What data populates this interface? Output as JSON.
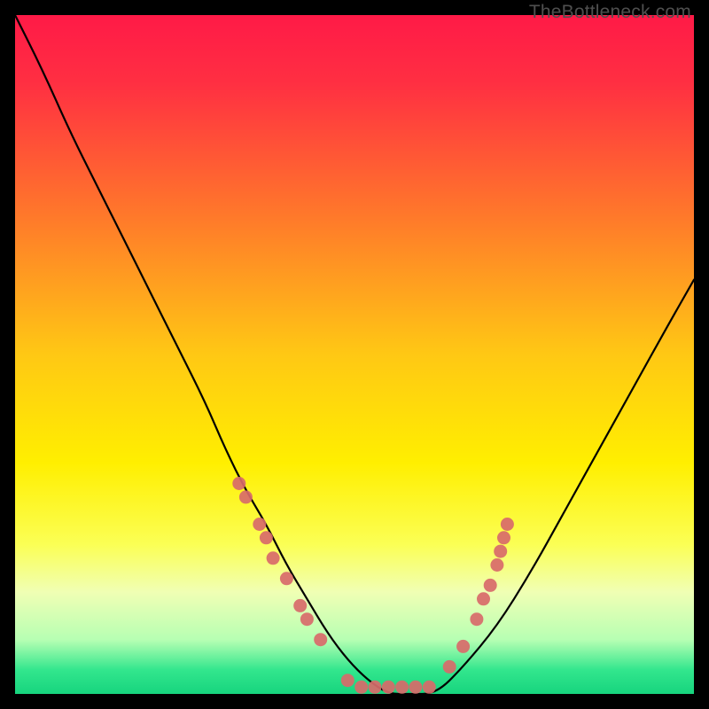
{
  "watermark": "TheBottleneck.com",
  "chart_data": {
    "type": "line",
    "title": "",
    "xlabel": "",
    "ylabel": "",
    "xlim": [
      0,
      100
    ],
    "ylim": [
      0,
      100
    ],
    "background_gradient_stops": [
      {
        "offset": 0.0,
        "color": "#ff1a47"
      },
      {
        "offset": 0.1,
        "color": "#ff2f42"
      },
      {
        "offset": 0.3,
        "color": "#ff7a2a"
      },
      {
        "offset": 0.5,
        "color": "#ffc814"
      },
      {
        "offset": 0.66,
        "color": "#ffef00"
      },
      {
        "offset": 0.78,
        "color": "#fbff55"
      },
      {
        "offset": 0.85,
        "color": "#f0ffb4"
      },
      {
        "offset": 0.92,
        "color": "#b7ffb3"
      },
      {
        "offset": 0.965,
        "color": "#32e68d"
      },
      {
        "offset": 1.0,
        "color": "#17d47e"
      }
    ],
    "series": [
      {
        "name": "bottleneck-curve",
        "color": "#000000",
        "x": [
          0,
          4,
          8,
          12,
          16,
          20,
          24,
          28,
          31,
          34,
          37,
          40,
          43,
          46,
          49,
          52,
          55,
          58,
          62,
          66,
          71,
          76,
          81,
          86,
          91,
          96,
          100
        ],
        "y": [
          100,
          92,
          83,
          75,
          67,
          59,
          51,
          43,
          36,
          30,
          25,
          19,
          14,
          9,
          5,
          2,
          0,
          0,
          0,
          4,
          10,
          18,
          27,
          36,
          45,
          54,
          61
        ]
      }
    ],
    "markers": [
      {
        "name": "left-cluster",
        "color": "#d86a6a",
        "points": [
          {
            "x": 33,
            "y": 31
          },
          {
            "x": 34,
            "y": 29
          },
          {
            "x": 36,
            "y": 25
          },
          {
            "x": 37,
            "y": 23
          },
          {
            "x": 38,
            "y": 20
          },
          {
            "x": 40,
            "y": 17
          },
          {
            "x": 42,
            "y": 13
          },
          {
            "x": 43,
            "y": 11
          },
          {
            "x": 45,
            "y": 8
          }
        ]
      },
      {
        "name": "valley-cluster",
        "color": "#d86a6a",
        "points": [
          {
            "x": 49,
            "y": 2
          },
          {
            "x": 51,
            "y": 1
          },
          {
            "x": 53,
            "y": 1
          },
          {
            "x": 55,
            "y": 1
          },
          {
            "x": 57,
            "y": 1
          },
          {
            "x": 59,
            "y": 1
          },
          {
            "x": 61,
            "y": 1
          }
        ]
      },
      {
        "name": "right-cluster",
        "color": "#d86a6a",
        "points": [
          {
            "x": 64,
            "y": 4
          },
          {
            "x": 66,
            "y": 7
          },
          {
            "x": 68,
            "y": 11
          },
          {
            "x": 69,
            "y": 14
          },
          {
            "x": 70,
            "y": 16
          },
          {
            "x": 71,
            "y": 19
          },
          {
            "x": 71.5,
            "y": 21
          },
          {
            "x": 72,
            "y": 23
          },
          {
            "x": 72.5,
            "y": 25
          }
        ]
      }
    ]
  }
}
